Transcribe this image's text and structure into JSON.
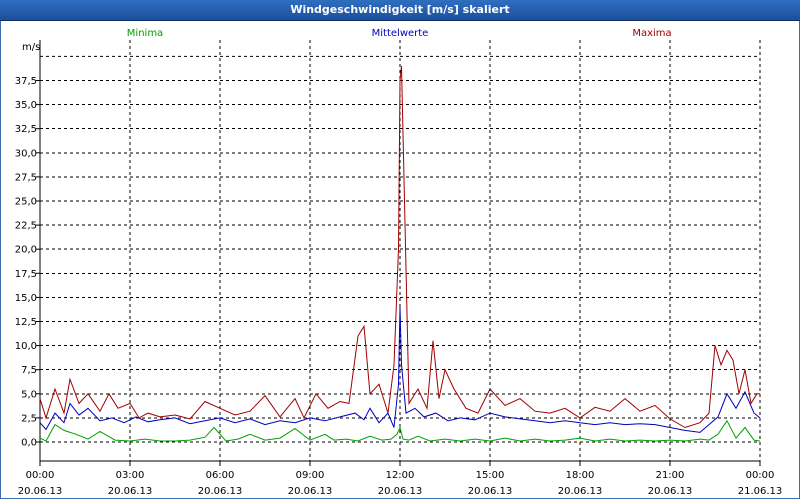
{
  "window": {
    "title": "Windgeschwindigkeit [m/s] skaliert"
  },
  "colors": {
    "minima": "#00a000",
    "mittelwerte": "#0000c0",
    "maxima": "#a00000",
    "title_bg": "#2458a8"
  },
  "chart_data": {
    "type": "line",
    "title": "Windgeschwindigkeit [m/s] skaliert",
    "ylabel": "m/s",
    "ylim": [
      0,
      40
    ],
    "xlim": [
      0,
      24
    ],
    "grid": true,
    "legend": [
      "Minima",
      "Mittelwerte",
      "Maxima"
    ],
    "y_ticks": [
      "0,0",
      "2,5",
      "5,0",
      "7,5",
      "10,0",
      "12,5",
      "15,0",
      "17,5",
      "20,0",
      "22,5",
      "25,0",
      "27,5",
      "30,0",
      "32,5",
      "35,0",
      "37,5"
    ],
    "x_ticks": [
      {
        "time": "00:00",
        "date": "20.06.13"
      },
      {
        "time": "03:00",
        "date": "20.06.13"
      },
      {
        "time": "06:00",
        "date": "20.06.13"
      },
      {
        "time": "09:00",
        "date": "20.06.13"
      },
      {
        "time": "12:00",
        "date": "20.06.13"
      },
      {
        "time": "15:00",
        "date": "20.06.13"
      },
      {
        "time": "18:00",
        "date": "20.06.13"
      },
      {
        "time": "21:00",
        "date": "20.06.13"
      },
      {
        "time": "00:00",
        "date": "21.06.13"
      }
    ],
    "series": [
      {
        "name": "Minima",
        "color": "#00a000",
        "x": [
          0,
          0.2,
          0.5,
          0.8,
          1.2,
          1.6,
          2.0,
          2.5,
          3.0,
          3.5,
          4.0,
          4.5,
          5.0,
          5.5,
          5.8,
          6.2,
          6.6,
          7.0,
          7.5,
          8.0,
          8.5,
          9.0,
          9.5,
          9.8,
          10.2,
          10.6,
          11.0,
          11.4,
          11.7,
          11.9,
          12.0,
          12.1,
          12.3,
          12.6,
          13.0,
          13.5,
          14.0,
          14.5,
          15.0,
          15.5,
          16.0,
          16.5,
          17.0,
          17.5,
          18.0,
          18.5,
          19.0,
          19.5,
          20.0,
          20.5,
          21.0,
          21.5,
          22.0,
          22.3,
          22.6,
          22.9,
          23.2,
          23.5,
          23.8,
          24
        ],
        "y": [
          0.4,
          0.1,
          1.8,
          1.2,
          0.8,
          0.3,
          1.1,
          0.2,
          0.1,
          0.3,
          0.1,
          0.1,
          0.2,
          0.5,
          1.5,
          0.1,
          0.3,
          0.8,
          0.2,
          0.4,
          1.4,
          0.2,
          0.8,
          0.2,
          0.3,
          0.1,
          0.6,
          0.2,
          0.3,
          0.8,
          1.5,
          0.3,
          0.2,
          0.6,
          0.1,
          0.3,
          0.1,
          0.3,
          0.1,
          0.4,
          0.1,
          0.3,
          0.1,
          0.2,
          0.4,
          0.1,
          0.3,
          0.1,
          0.2,
          0.1,
          0.2,
          0.1,
          0.3,
          0.2,
          0.8,
          2.2,
          0.4,
          1.5,
          0.2,
          0.1
        ]
      },
      {
        "name": "Mittelwerte",
        "color": "#0000c0",
        "x": [
          0,
          0.2,
          0.5,
          0.8,
          1.0,
          1.3,
          1.6,
          2.0,
          2.4,
          2.8,
          3.2,
          3.6,
          4.0,
          4.5,
          5.0,
          5.5,
          6.0,
          6.5,
          7.0,
          7.5,
          8.0,
          8.5,
          9.0,
          9.5,
          10.0,
          10.5,
          10.8,
          11.0,
          11.3,
          11.6,
          11.8,
          11.95,
          12.0,
          12.05,
          12.2,
          12.5,
          12.8,
          13.2,
          13.6,
          14.0,
          14.5,
          15.0,
          15.5,
          16.0,
          16.5,
          17.0,
          17.5,
          18.0,
          18.5,
          19.0,
          19.5,
          20.0,
          20.5,
          21.0,
          21.5,
          22.0,
          22.3,
          22.6,
          22.9,
          23.2,
          23.5,
          23.8,
          24
        ],
        "y": [
          2.0,
          1.3,
          3.0,
          2.0,
          4.0,
          2.8,
          3.5,
          2.2,
          2.5,
          2.0,
          2.6,
          2.1,
          2.3,
          2.5,
          1.9,
          2.2,
          2.5,
          2.0,
          2.4,
          1.8,
          2.2,
          2.0,
          2.5,
          2.2,
          2.6,
          3.0,
          2.3,
          3.5,
          2.0,
          3.0,
          1.5,
          6.0,
          14.0,
          8.0,
          3.0,
          3.5,
          2.6,
          3.0,
          2.2,
          2.5,
          2.3,
          3.0,
          2.6,
          2.4,
          2.2,
          2.0,
          2.2,
          2.0,
          1.8,
          2.0,
          1.8,
          1.9,
          1.8,
          1.5,
          1.2,
          1.0,
          1.8,
          2.6,
          5.0,
          3.5,
          5.2,
          3.0,
          2.5
        ]
      },
      {
        "name": "Maxima",
        "color": "#a00000",
        "x": [
          0,
          0.2,
          0.5,
          0.8,
          1.0,
          1.3,
          1.6,
          2.0,
          2.3,
          2.6,
          3.0,
          3.3,
          3.6,
          4.0,
          4.5,
          5.0,
          5.5,
          6.0,
          6.5,
          7.0,
          7.5,
          8.0,
          8.5,
          8.8,
          9.2,
          9.6,
          10.0,
          10.3,
          10.6,
          10.8,
          11.0,
          11.3,
          11.6,
          11.8,
          11.95,
          12.0,
          12.05,
          12.15,
          12.3,
          12.6,
          12.9,
          13.1,
          13.3,
          13.5,
          13.8,
          14.2,
          14.6,
          15.0,
          15.5,
          16.0,
          16.5,
          17.0,
          17.5,
          18.0,
          18.5,
          19.0,
          19.5,
          20.0,
          20.5,
          21.0,
          21.5,
          22.0,
          22.3,
          22.5,
          22.7,
          22.9,
          23.1,
          23.3,
          23.5,
          23.7,
          23.9,
          24
        ],
        "y": [
          4.5,
          2.5,
          5.5,
          3.0,
          6.5,
          4.0,
          5.0,
          3.2,
          5.0,
          3.5,
          4.0,
          2.5,
          3.0,
          2.6,
          2.8,
          2.4,
          4.2,
          3.5,
          2.8,
          3.2,
          4.8,
          2.6,
          4.5,
          2.5,
          5.0,
          3.5,
          4.2,
          4.0,
          11.0,
          12.0,
          5.0,
          6.0,
          3.0,
          8.0,
          20.0,
          37.5,
          39.0,
          25.0,
          4.0,
          5.5,
          3.5,
          10.5,
          4.5,
          7.5,
          5.5,
          3.5,
          3.0,
          5.5,
          3.8,
          4.5,
          3.2,
          3.0,
          3.5,
          2.5,
          3.6,
          3.2,
          4.5,
          3.2,
          3.8,
          2.4,
          1.5,
          2.0,
          3.0,
          10.0,
          8.0,
          9.5,
          8.5,
          5.0,
          7.5,
          4.0,
          5.0,
          5.0
        ]
      }
    ]
  }
}
